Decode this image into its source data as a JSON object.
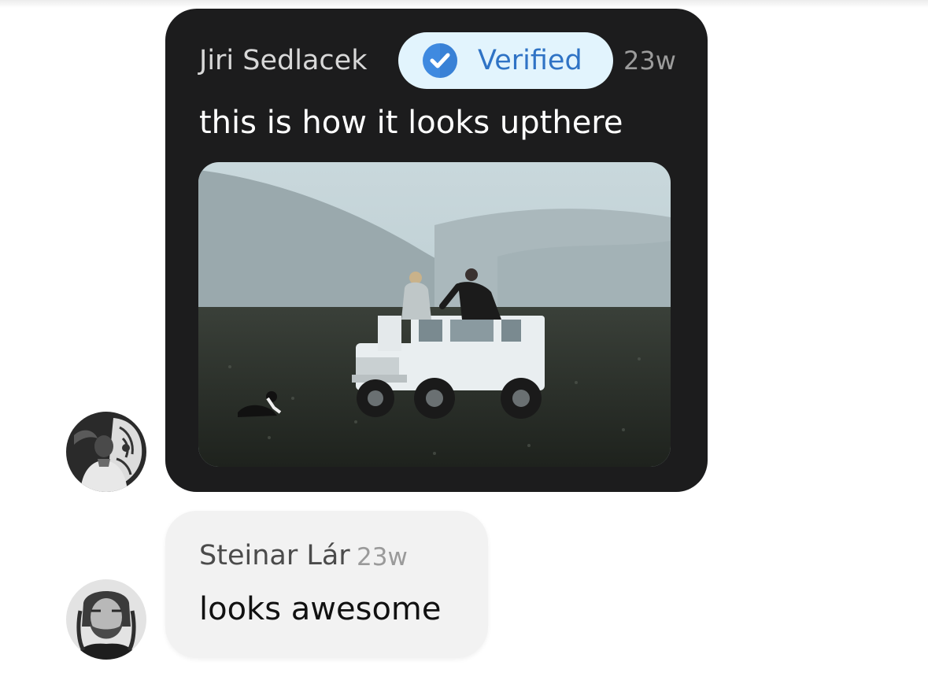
{
  "messages": [
    {
      "author": "Jiri Sedlacek",
      "badge": {
        "label": "Verified",
        "icon": "checkmark-badge-icon",
        "color": "#2f73c5",
        "background": "#e2f4fd"
      },
      "time": "23w",
      "text": "this is how it looks upthere",
      "attachment": {
        "type": "photo",
        "icon": "photo-attachment"
      },
      "avatar": "avatar-jiri-sedlacek",
      "bubble_color": "#1c1c1d"
    },
    {
      "author": "Steinar Lár",
      "time": "23w",
      "text": "looks awesome",
      "avatar": "avatar-steinar-lar",
      "bubble_color": "#f2f2f2"
    }
  ]
}
